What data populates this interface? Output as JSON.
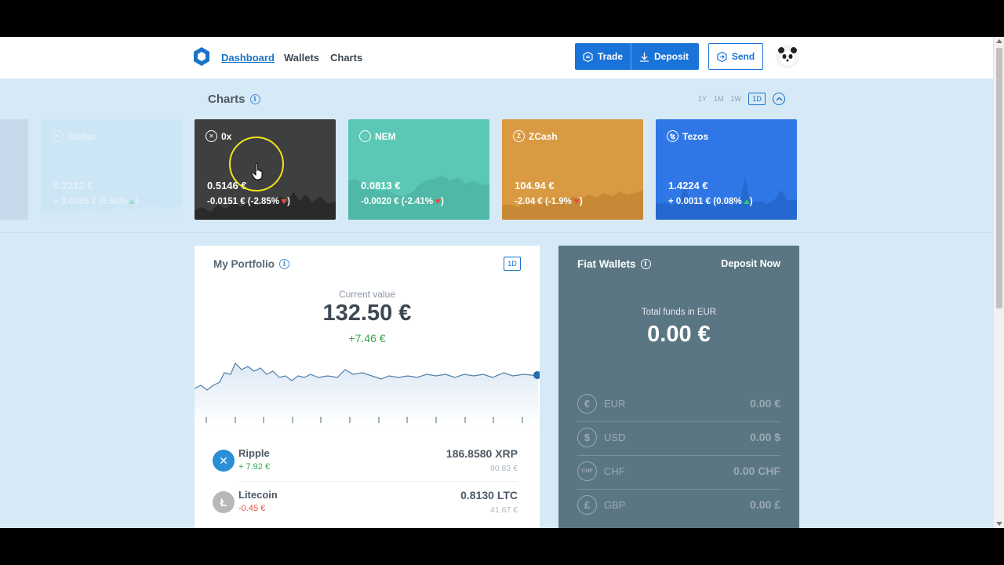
{
  "header": {
    "nav": [
      "Dashboard",
      "Wallets",
      "Charts"
    ],
    "trade_label": "Trade",
    "deposit_label": "Deposit",
    "send_label": "Send"
  },
  "charts_section": {
    "title": "Charts",
    "ranges": [
      "1Y",
      "1M",
      "1W",
      "1D"
    ],
    "active_range": "1D"
  },
  "coins": [
    {
      "name": "Stellar",
      "price": "0.2212 €",
      "change": "+ 0.0135 € (6.56%",
      "trend": "up",
      "color": "#bfe3f4",
      "faded": true
    },
    {
      "name": "0x",
      "price": "0.5146 €",
      "change": "-0.0151 € (-2.85%",
      "trend": "down",
      "color": "#3f3f40",
      "faded": false
    },
    {
      "name": "NEM",
      "price": "0.0813 €",
      "change": "-0.0020 € (-2.41%",
      "trend": "down",
      "color": "#5bc8b5",
      "faded": false
    },
    {
      "name": "ZCash",
      "price": "104.94 €",
      "change": "-2.04 € (-1.9%",
      "trend": "down",
      "color": "#d99a42",
      "faded": false
    },
    {
      "name": "Tezos",
      "price": "1.4224 €",
      "change": "+ 0.0011 € (0.08%",
      "trend": "up",
      "color": "#2f77e6",
      "faded": false
    }
  ],
  "portfolio": {
    "title": "My Portfolio",
    "range": "1D",
    "current_label": "Current value",
    "current_value": "132.50 €",
    "current_change": "+7.46 €",
    "assets": [
      {
        "name": "Ripple",
        "change": "+ 7.92 €",
        "change_color": "#39a24d",
        "amount": "186.8580 XRP",
        "eur": "90.83 €",
        "icon_color": "#2a8fd6"
      },
      {
        "name": "Litecoin",
        "change": "-0.45 €",
        "change_color": "#e0574a",
        "amount": "0.8130 LTC",
        "eur": "41.67 €",
        "icon_color": "#b8b8b8"
      }
    ]
  },
  "fiat": {
    "title": "Fiat Wallets",
    "deposit_now": "Deposit Now",
    "total_label": "Total funds in EUR",
    "total_value": "0.00 €",
    "currencies": [
      {
        "code": "EUR",
        "symbol": "€",
        "amount": "0.00 €"
      },
      {
        "code": "USD",
        "symbol": "$",
        "amount": "0.00 $"
      },
      {
        "code": "CHF",
        "symbol": "CHF",
        "amount": "0.00 CHF"
      },
      {
        "code": "GBP",
        "symbol": "£",
        "amount": "0.00 £"
      }
    ]
  }
}
